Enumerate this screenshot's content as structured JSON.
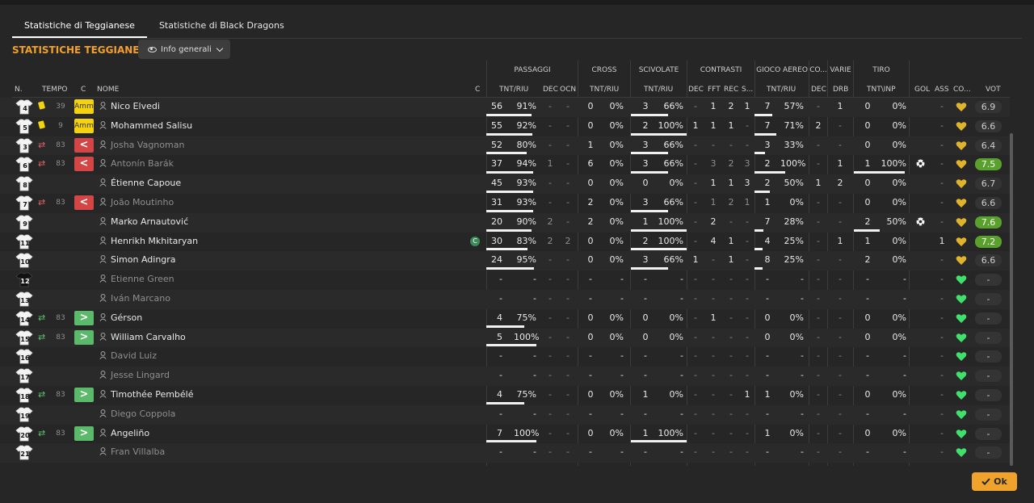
{
  "tabs": [
    {
      "label": "Statistiche di Teggianese",
      "active": true
    },
    {
      "label": "Statistiche di Black Dragons",
      "active": false
    }
  ],
  "section_title": "STATISTICHE TEGGIANESE",
  "view_dropdown": {
    "label": "Info generali",
    "icon": "eye-icon"
  },
  "group_headers": [
    "PASSAGGI",
    "CROSS",
    "SCIVOLATE",
    "CONTRASTI",
    "GIOCO AEREO",
    "CO...",
    "VARIE",
    "TIRO"
  ],
  "column_headers": {
    "num": "N.",
    "time": "TEMPO",
    "c1": "C",
    "name": "NOME",
    "c2": "C",
    "pass_tnt": "TNT/RIU",
    "pass_dec": "DEC",
    "pass_ocn": "OCN",
    "cross_tnt": "TNT/RIU",
    "tack_tnt": "TNT/RIU",
    "con_dec": "DEC",
    "con_fft": "FFT",
    "con_rec": "REC",
    "con_s": "S...",
    "air_tnt": "TNT/RIU",
    "co_dec": "DEC",
    "var_drb": "DRB",
    "shot_tnt": "TNT\\INP",
    "gol": "GOL",
    "ass": "ASS",
    "co": "CO...",
    "vot": "VOT"
  },
  "colors": {
    "accent": "#f2a02e",
    "card": "#f5d20e",
    "sub_out": "#d44646",
    "sub_in": "#5ab96a",
    "heart_green": "#3fe06b",
    "heart_gold": "#e0b32c",
    "rating_good": "#5aa02c"
  },
  "players": [
    {
      "num": "4",
      "time": "39",
      "event": "card",
      "badge": "Amm",
      "name": "Nico Elvedi",
      "active": true,
      "pass": [
        "56",
        "91%"
      ],
      "pass_frac": 0.91,
      "pass_dec": "-",
      "pass_ocn": "-",
      "cross": [
        "0",
        "0%"
      ],
      "tack": [
        "3",
        "66%"
      ],
      "tack_frac": 0.66,
      "con": [
        "-",
        "1",
        "2",
        "1"
      ],
      "air": [
        "7",
        "57%"
      ],
      "air_frac": 0.57,
      "co_dec": "-",
      "drb": "1",
      "shot": [
        "0",
        "0%"
      ],
      "gol": "",
      "ass": "-",
      "heart": "gold",
      "rating": "6.9",
      "good": false
    },
    {
      "num": "5",
      "time": "9",
      "event": "card",
      "badge": "Amm",
      "name": "Mohammed Salisu",
      "active": true,
      "pass": [
        "55",
        "92%"
      ],
      "pass_frac": 0.92,
      "pass_dec": "-",
      "pass_ocn": "-",
      "cross": [
        "0",
        "0%"
      ],
      "tack": [
        "2",
        "100%"
      ],
      "tack_frac": 1.0,
      "con": [
        "1",
        "1",
        "1",
        "-"
      ],
      "air": [
        "7",
        "71%"
      ],
      "air_frac": 0.71,
      "co_dec": "2",
      "drb": "-",
      "shot": [
        "0",
        "0%"
      ],
      "gol": "",
      "ass": "-",
      "heart": "gold",
      "rating": "6.6",
      "good": false
    },
    {
      "num": "3",
      "time": "83",
      "event": "out",
      "badge": "<",
      "name": "Josha Vagnoman",
      "active": false,
      "pass": [
        "52",
        "80%"
      ],
      "pass_frac": 0.8,
      "pass_dec": "-",
      "pass_ocn": "-",
      "cross": [
        "1",
        "0%"
      ],
      "tack": [
        "3",
        "66%"
      ],
      "tack_frac": 0.66,
      "con": [
        "-",
        "-",
        "-",
        "-"
      ],
      "air": [
        "3",
        "33%"
      ],
      "air_frac": 0.33,
      "co_dec": "-",
      "drb": "-",
      "shot": [
        "0",
        "0%"
      ],
      "gol": "",
      "ass": "-",
      "heart": "gold",
      "rating": "6.4",
      "good": false
    },
    {
      "num": "6",
      "time": "83",
      "event": "out",
      "badge": "<",
      "name": "Antonín Barák",
      "active": false,
      "pass": [
        "37",
        "94%"
      ],
      "pass_frac": 0.94,
      "pass_dec": "1",
      "pass_ocn": "-",
      "cross": [
        "6",
        "0%"
      ],
      "tack": [
        "3",
        "66%"
      ],
      "tack_frac": 0.66,
      "con": [
        "-",
        "3",
        "2",
        "3"
      ],
      "air": [
        "2",
        "100%"
      ],
      "air_frac": 1.0,
      "co_dec": "-",
      "drb": "1",
      "shot": [
        "1",
        "100%"
      ],
      "shot_frac": 1.0,
      "gol": "ball",
      "ass": "-",
      "heart": "gold",
      "rating": "7.5",
      "good": true
    },
    {
      "num": "8",
      "time": "",
      "event": "",
      "badge": "",
      "name": "Étienne Capoue",
      "active": true,
      "pass": [
        "45",
        "93%"
      ],
      "pass_frac": 0.93,
      "pass_dec": "-",
      "pass_ocn": "-",
      "cross": [
        "0",
        "0%"
      ],
      "tack": [
        "0",
        "0%"
      ],
      "con": [
        "-",
        "1",
        "1",
        "3"
      ],
      "air": [
        "2",
        "50%"
      ],
      "air_frac": 0.5,
      "co_dec": "1",
      "drb": "2",
      "shot": [
        "0",
        "0%"
      ],
      "gol": "",
      "ass": "-",
      "heart": "gold",
      "rating": "6.7",
      "good": false
    },
    {
      "num": "7",
      "time": "83",
      "event": "out",
      "badge": "<",
      "name": "João Moutinho",
      "active": false,
      "pass": [
        "31",
        "93%"
      ],
      "pass_frac": 0.93,
      "pass_dec": "-",
      "pass_ocn": "-",
      "cross": [
        "2",
        "0%"
      ],
      "tack": [
        "3",
        "66%"
      ],
      "tack_frac": 0.66,
      "con": [
        "-",
        "1",
        "2",
        "1"
      ],
      "air": [
        "1",
        "0%"
      ],
      "co_dec": "-",
      "drb": "-",
      "shot": [
        "0",
        "0%"
      ],
      "gol": "",
      "ass": "-",
      "heart": "gold",
      "rating": "6.6",
      "good": false
    },
    {
      "num": "9",
      "time": "",
      "event": "",
      "badge": "",
      "name": "Marko Arnautović",
      "active": true,
      "pass": [
        "20",
        "90%"
      ],
      "pass_frac": 0.9,
      "pass_dec": "2",
      "pass_ocn": "-",
      "cross": [
        "2",
        "0%"
      ],
      "tack": [
        "1",
        "100%"
      ],
      "tack_frac": 1.0,
      "con": [
        "-",
        "2",
        "-",
        "-"
      ],
      "air": [
        "7",
        "28%"
      ],
      "air_frac": 0.28,
      "co_dec": "-",
      "drb": "-",
      "shot": [
        "2",
        "50%"
      ],
      "shot_frac": 0.5,
      "gol": "ball",
      "ass": "-",
      "heart": "gold",
      "rating": "7.6",
      "good": true
    },
    {
      "num": "11",
      "time": "",
      "event": "",
      "badge": "",
      "name": "Henrikh Mkhitaryan",
      "active": true,
      "captain": "C",
      "pass": [
        "30",
        "83%"
      ],
      "pass_frac": 0.83,
      "pass_dec": "2",
      "pass_ocn": "2",
      "cross": [
        "0",
        "0%"
      ],
      "tack": [
        "2",
        "100%"
      ],
      "tack_frac": 1.0,
      "con": [
        "-",
        "4",
        "1",
        "-"
      ],
      "air": [
        "4",
        "25%"
      ],
      "air_frac": 0.25,
      "co_dec": "-",
      "drb": "1",
      "shot": [
        "1",
        "0%"
      ],
      "gol": "",
      "ass": "1",
      "heart": "gold",
      "rating": "7.2",
      "good": true
    },
    {
      "num": "10",
      "time": "",
      "event": "",
      "badge": "",
      "name": "Simon Adingra",
      "active": true,
      "pass": [
        "24",
        "95%"
      ],
      "pass_frac": 0.95,
      "pass_dec": "-",
      "pass_ocn": "-",
      "cross": [
        "0",
        "0%"
      ],
      "tack": [
        "3",
        "66%"
      ],
      "tack_frac": 0.66,
      "con": [
        "1",
        "-",
        "1",
        "-"
      ],
      "air": [
        "8",
        "25%"
      ],
      "air_frac": 0.25,
      "co_dec": "-",
      "drb": "-",
      "shot": [
        "2",
        "0%"
      ],
      "gol": "",
      "ass": "-",
      "heart": "gold",
      "rating": "6.6",
      "good": false
    },
    {
      "num": "12",
      "time": "",
      "event": "",
      "badge": "",
      "name": "Etienne Green",
      "active": false,
      "keeper": true,
      "pass": [
        "-",
        "-"
      ],
      "pass_dec": "-",
      "pass_ocn": "-",
      "cross": [
        "-",
        "-"
      ],
      "tack": [
        "-",
        "-"
      ],
      "con": [
        "-",
        "-",
        "-",
        "-"
      ],
      "air": [
        "-",
        "-"
      ],
      "co_dec": "-",
      "drb": "-",
      "shot": [
        "-",
        "-"
      ],
      "gol": "",
      "ass": "-",
      "heart": "green",
      "rating": "-",
      "good": false
    },
    {
      "num": "13",
      "time": "",
      "event": "",
      "badge": "",
      "name": "Iván Marcano",
      "active": false,
      "pass": [
        "-",
        "-"
      ],
      "pass_dec": "-",
      "pass_ocn": "-",
      "cross": [
        "-",
        "-"
      ],
      "tack": [
        "-",
        "-"
      ],
      "con": [
        "-",
        "-",
        "-",
        "-"
      ],
      "air": [
        "-",
        "-"
      ],
      "co_dec": "-",
      "drb": "-",
      "shot": [
        "-",
        "-"
      ],
      "gol": "",
      "ass": "-",
      "heart": "green",
      "rating": "-",
      "good": false
    },
    {
      "num": "14",
      "time": "83",
      "event": "in",
      "badge": ">",
      "name": "Gérson",
      "active": true,
      "pass": [
        "4",
        "75%"
      ],
      "pass_frac": 0.75,
      "pass_dec": "-",
      "pass_ocn": "-",
      "cross": [
        "0",
        "0%"
      ],
      "tack": [
        "0",
        "0%"
      ],
      "con": [
        "-",
        "1",
        "-",
        "-"
      ],
      "air": [
        "0",
        "0%"
      ],
      "co_dec": "-",
      "drb": "-",
      "shot": [
        "0",
        "0%"
      ],
      "gol": "",
      "ass": "-",
      "heart": "green",
      "rating": "-",
      "good": false
    },
    {
      "num": "15",
      "time": "83",
      "event": "in",
      "badge": ">",
      "name": "William Carvalho",
      "active": true,
      "pass": [
        "5",
        "100%"
      ],
      "pass_frac": 1.0,
      "pass_dec": "-",
      "pass_ocn": "-",
      "cross": [
        "0",
        "0%"
      ],
      "tack": [
        "0",
        "0%"
      ],
      "con": [
        "-",
        "-",
        "-",
        "-"
      ],
      "air": [
        "0",
        "0%"
      ],
      "co_dec": "-",
      "drb": "-",
      "shot": [
        "0",
        "0%"
      ],
      "gol": "",
      "ass": "-",
      "heart": "green",
      "rating": "-",
      "good": false
    },
    {
      "num": "16",
      "time": "",
      "event": "",
      "badge": "",
      "name": "David Luiz",
      "active": false,
      "pass": [
        "-",
        "-"
      ],
      "pass_dec": "-",
      "pass_ocn": "-",
      "cross": [
        "-",
        "-"
      ],
      "tack": [
        "-",
        "-"
      ],
      "con": [
        "-",
        "-",
        "-",
        "-"
      ],
      "air": [
        "-",
        "-"
      ],
      "co_dec": "-",
      "drb": "-",
      "shot": [
        "-",
        "-"
      ],
      "gol": "",
      "ass": "-",
      "heart": "green",
      "rating": "-",
      "good": false
    },
    {
      "num": "17",
      "time": "",
      "event": "",
      "badge": "",
      "name": "Jesse Lingard",
      "active": false,
      "pass": [
        "-",
        "-"
      ],
      "pass_dec": "-",
      "pass_ocn": "-",
      "cross": [
        "-",
        "-"
      ],
      "tack": [
        "-",
        "-"
      ],
      "con": [
        "-",
        "-",
        "-",
        "-"
      ],
      "air": [
        "-",
        "-"
      ],
      "co_dec": "-",
      "drb": "-",
      "shot": [
        "-",
        "-"
      ],
      "gol": "",
      "ass": "-",
      "heart": "green",
      "rating": "-",
      "good": false
    },
    {
      "num": "18",
      "time": "83",
      "event": "in",
      "badge": ">",
      "name": "Timothée Pembélé",
      "active": true,
      "pass": [
        "4",
        "75%"
      ],
      "pass_frac": 0.75,
      "pass_dec": "-",
      "pass_ocn": "-",
      "cross": [
        "0",
        "0%"
      ],
      "tack": [
        "1",
        "0%"
      ],
      "con": [
        "-",
        "-",
        "-",
        "1"
      ],
      "air": [
        "1",
        "0%"
      ],
      "co_dec": "-",
      "drb": "-",
      "shot": [
        "0",
        "0%"
      ],
      "gol": "",
      "ass": "-",
      "heart": "green",
      "rating": "-",
      "good": false
    },
    {
      "num": "19",
      "time": "",
      "event": "",
      "badge": "",
      "name": "Diego Coppola",
      "active": false,
      "pass": [
        "-",
        "-"
      ],
      "pass_dec": "-",
      "pass_ocn": "-",
      "cross": [
        "-",
        "-"
      ],
      "tack": [
        "-",
        "-"
      ],
      "con": [
        "-",
        "-",
        "-",
        "-"
      ],
      "air": [
        "-",
        "-"
      ],
      "co_dec": "-",
      "drb": "-",
      "shot": [
        "-",
        "-"
      ],
      "gol": "",
      "ass": "-",
      "heart": "green",
      "rating": "-",
      "good": false
    },
    {
      "num": "20",
      "time": "83",
      "event": "in",
      "badge": ">",
      "name": "Angeliño",
      "active": true,
      "pass": [
        "7",
        "100%"
      ],
      "pass_frac": 1.0,
      "pass_dec": "-",
      "pass_ocn": "-",
      "cross": [
        "0",
        "0%"
      ],
      "tack": [
        "1",
        "100%"
      ],
      "tack_frac": 1.0,
      "con": [
        "-",
        "-",
        "-",
        "-"
      ],
      "air": [
        "1",
        "0%"
      ],
      "co_dec": "-",
      "drb": "-",
      "shot": [
        "0",
        "0%"
      ],
      "gol": "",
      "ass": "-",
      "heart": "green",
      "rating": "-",
      "good": false
    },
    {
      "num": "21",
      "time": "",
      "event": "",
      "badge": "",
      "name": "Fran Villalba",
      "active": false,
      "pass": [
        "-",
        "-"
      ],
      "pass_dec": "-",
      "pass_ocn": "-",
      "cross": [
        "-",
        "-"
      ],
      "tack": [
        "-",
        "-"
      ],
      "con": [
        "-",
        "-",
        "-",
        "-"
      ],
      "air": [
        "-",
        "-"
      ],
      "co_dec": "-",
      "drb": "-",
      "shot": [
        "-",
        "-"
      ],
      "gol": "",
      "ass": "-",
      "heart": "green",
      "rating": "-",
      "good": false
    }
  ],
  "ok_button": {
    "label": "Ok",
    "icon": "check-icon"
  }
}
